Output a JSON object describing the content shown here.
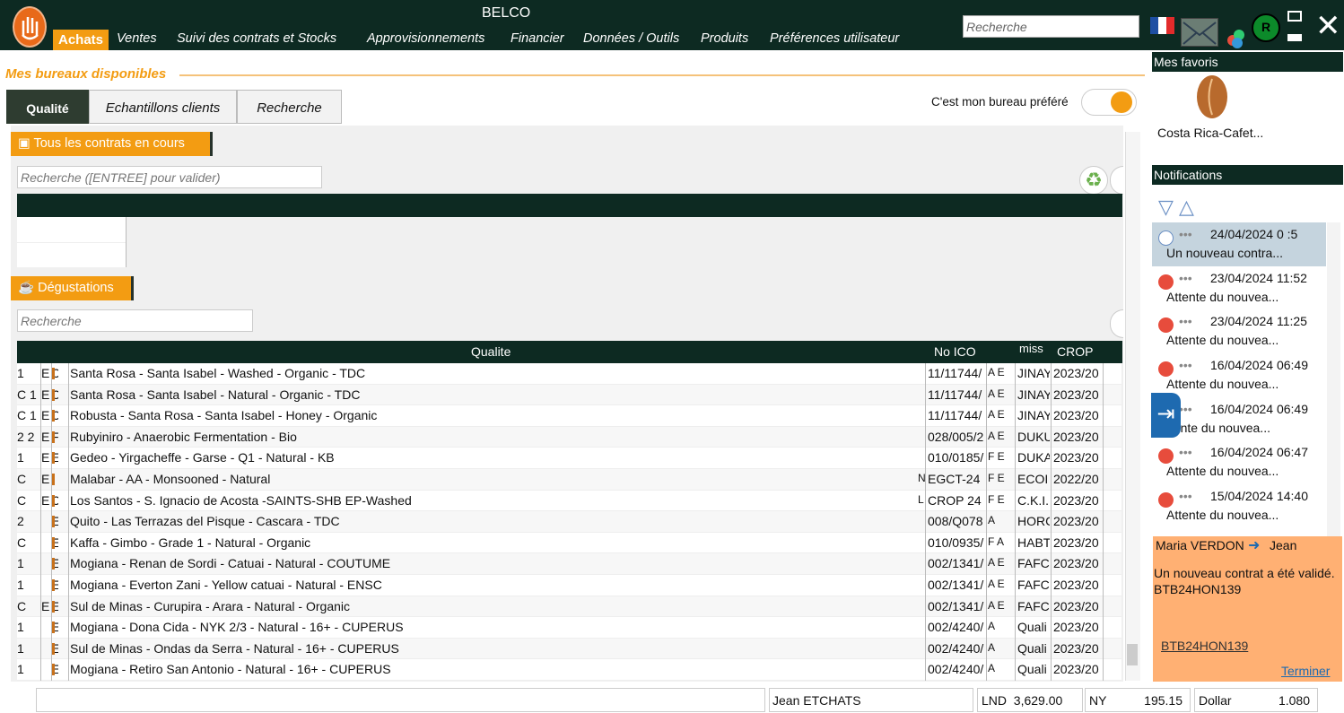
{
  "app": {
    "title": "BELCO"
  },
  "menu": {
    "achats": "Achats",
    "items": [
      "Ventes",
      "Suivi des contrats et Stocks",
      "Approvisionnements",
      "Financier",
      "Données / Outils",
      "Produits",
      "Préférences utilisateur"
    ]
  },
  "topbar": {
    "search_placeholder": "Recherche",
    "flag_colors": [
      "#1e4fa3",
      "#ffffff",
      "#e22b2b"
    ]
  },
  "office": {
    "title": "Mes bureaux disponibles",
    "tabs": [
      "Qualité",
      "Echantillons clients",
      "Recherche"
    ],
    "favorite_label": "C'est mon bureau préféré",
    "favorite_on": true
  },
  "contracts": {
    "tag": "Tous les contrats en cours",
    "search_placeholder": "Recherche ([ENTREE] pour valider)"
  },
  "tastings": {
    "tag": "Dégustations",
    "search_placeholder": "Recherche",
    "headers": {
      "qualite": "Qualite",
      "ico": "No ICO",
      "miss": "miss",
      "crop": "CROP"
    },
    "rows": [
      {
        "c0": "1",
        "c1": "E",
        "c2": "C",
        "q": "Santa Rosa - Santa Isabel - Washed - Organic - TDC",
        "m": "",
        "ico": "11/11744/",
        "x": "A E",
        "miss": "JINAY",
        "crop": "2023/20"
      },
      {
        "c0": "C 1",
        "c1": "E",
        "c2": "C",
        "q": "Santa Rosa - Santa Isabel - Natural - Organic - TDC",
        "m": "",
        "ico": "11/11744/",
        "x": "A E",
        "miss": "JINAY",
        "crop": "2023/20"
      },
      {
        "c0": "C 1",
        "c1": "E",
        "c2": "C",
        "q": "Robusta - Santa Rosa - Santa Isabel - Honey - Organic",
        "m": "",
        "ico": "11/11744/",
        "x": "A E",
        "miss": "JINAY",
        "crop": "2023/20"
      },
      {
        "c0": "2 2",
        "c1": "E",
        "c2": "F",
        "q": "Rubyiniro - Anaerobic Fermentation - Bio",
        "m": "",
        "ico": "028/005/2",
        "x": "A E",
        "miss": "DUKU",
        "crop": "2023/20"
      },
      {
        "c0": "1",
        "c1": "E",
        "c2": "E",
        "q": "Gedeo - Yirgacheffe - Garse - Q1 - Natural - KB",
        "m": "",
        "ico": "010/0185/",
        "x": "F E",
        "miss": "DUKA",
        "crop": "2023/20"
      },
      {
        "c0": "C",
        "c1": "E",
        "c2": "I",
        "q": "Malabar - AA - Monsooned - Natural",
        "m": "N",
        "ico": "EGCT-24",
        "x": "F E",
        "miss": "ECOI",
        "crop": "2022/20"
      },
      {
        "c0": "C",
        "c1": "E",
        "c2": "C",
        "q": "Los Santos - S. Ignacio de Acosta -SAINTS-SHB EP-Washed",
        "m": "L",
        "ico": "CROP 24",
        "x": "F E",
        "miss": "C.K.I.",
        "crop": "2023/20"
      },
      {
        "c0": "2",
        "c1": "",
        "c2": "E",
        "q": "Quito - Las Terrazas del Pisque - Cascara - TDC",
        "m": "",
        "ico": "008/Q078",
        "x": "A",
        "miss": "HORC",
        "crop": "2023/20"
      },
      {
        "c0": "C",
        "c1": "",
        "c2": "E",
        "q": "Kaffa - Gimbo - Grade 1  - Natural - Organic",
        "m": "",
        "ico": "010/0935/",
        "x": "F A",
        "miss": "HABT",
        "crop": "2023/20"
      },
      {
        "c0": "1",
        "c1": "",
        "c2": "E",
        "q": "Mogiana - Renan de Sordi - Catuai - Natural - COUTUME",
        "m": "",
        "ico": "002/1341/",
        "x": "A E",
        "miss": "FAFC",
        "crop": "2023/20"
      },
      {
        "c0": "1",
        "c1": "",
        "c2": "E",
        "q": "Mogiana - Everton Zani - Yellow catuai - Natural - ENSC",
        "m": "",
        "ico": "002/1341/",
        "x": "A E",
        "miss": "FAFC",
        "crop": "2023/20"
      },
      {
        "c0": "C",
        "c1": "E",
        "c2": "E",
        "q": "Sul de Minas - Curupira - Arara - Natural - Organic",
        "m": "",
        "ico": "002/1341/",
        "x": "A E",
        "miss": "FAFC",
        "crop": "2023/20"
      },
      {
        "c0": "1",
        "c1": "",
        "c2": "E",
        "q": "Mogiana - Dona Cida - NYK 2/3 - Natural - 16+ - CUPERUS",
        "m": "",
        "ico": "002/4240/",
        "x": "A",
        "miss": "Quali",
        "crop": "2023/20"
      },
      {
        "c0": "1",
        "c1": "",
        "c2": "E",
        "q": "Sul de Minas - Ondas da Serra - Natural - 16+ - CUPERUS",
        "m": "",
        "ico": "002/4240/",
        "x": "A",
        "miss": "Quali",
        "crop": "2023/20"
      },
      {
        "c0": "1",
        "c1": "",
        "c2": "E",
        "q": "Mogiana - Retiro San Antonio - Natural - 16+ - CUPERUS",
        "m": "",
        "ico": "002/4240/",
        "x": "A",
        "miss": "Quali",
        "crop": "2023/20"
      }
    ]
  },
  "favorites": {
    "header": "Mes favoris",
    "items": [
      "Costa Rica-Cafet..."
    ]
  },
  "notifications": {
    "header": "Notifications",
    "items": [
      {
        "date": "24/04/2024 0 :5",
        "text": "Un nouveau contra...",
        "type": "info"
      },
      {
        "date": "23/04/2024 11:52",
        "text": "Attente du nouvea...",
        "type": "alert"
      },
      {
        "date": "23/04/2024 11:25",
        "text": "Attente du nouvea...",
        "type": "alert"
      },
      {
        "date": "16/04/2024 06:49",
        "text": "Attente du nouvea...",
        "type": "alert"
      },
      {
        "date": "16/04/2024 06:49",
        "text": "ttente du nouvea...",
        "type": "alert"
      },
      {
        "date": "16/04/2024 06:47",
        "text": "Attente du nouvea...",
        "type": "alert"
      },
      {
        "date": "15/04/2024 14:40",
        "text": "Attente du nouvea...",
        "type": "alert"
      }
    ]
  },
  "message": {
    "from": "Maria VERDON",
    "to": "Jean",
    "body": "Un nouveau contrat a été validé. BTB24HON139",
    "link": "BTB24HON139",
    "end": "Terminer"
  },
  "status": {
    "user": "Jean ETCHATS",
    "lnd_label": "LND",
    "lnd_value": "3,629.00",
    "ny_label": "NY",
    "ny_value": "195.15",
    "dollar_label": "Dollar",
    "dollar_value": "1.080"
  }
}
